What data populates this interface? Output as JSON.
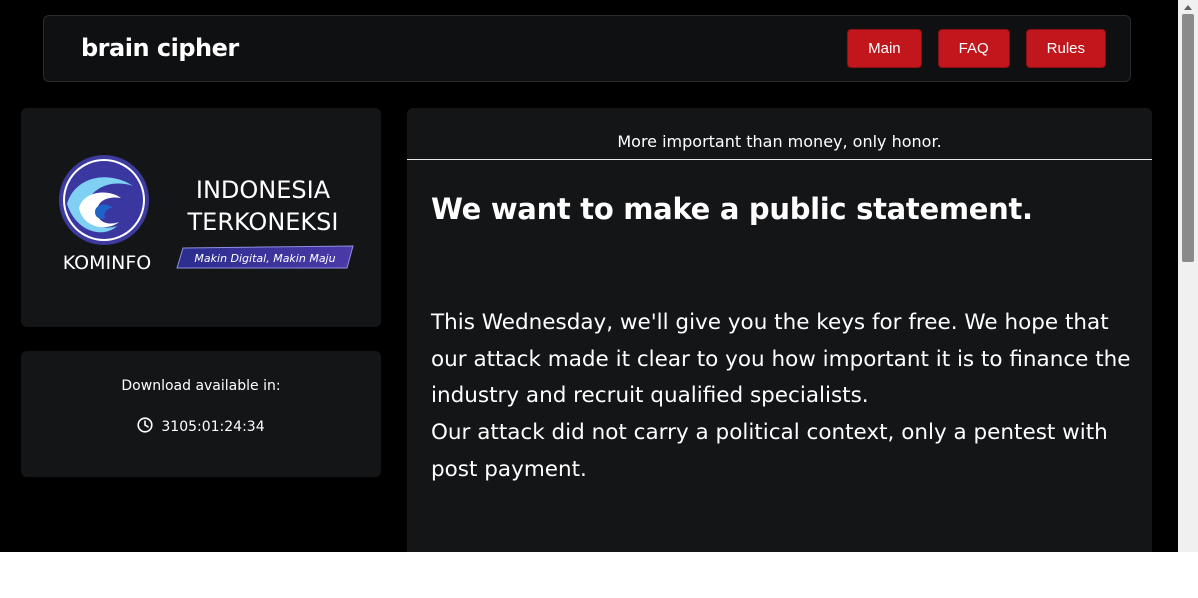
{
  "header": {
    "brand": "brain cipher",
    "nav": [
      {
        "label": "Main"
      },
      {
        "label": "FAQ"
      },
      {
        "label": "Rules"
      }
    ]
  },
  "logo": {
    "org": "KOMINFO",
    "line1": "INDONESIA",
    "line2": "TERKONEKSI",
    "slogan": "Makin Digital, Makin Maju"
  },
  "timer": {
    "title": "Download available in:",
    "countdown": "3105:01:24:34",
    "icon": "clock-icon"
  },
  "main": {
    "tagline": "More important than money, only honor.",
    "heading": "We want to make a public statement.",
    "paragraph1": "This Wednesday, we'll give you the keys for free. We hope that our attack made it clear to you how important it is to finance the industry and recruit qualified specialists.",
    "paragraph2": "Our attack did not carry a political context, only a pentest with post payment."
  },
  "colors": {
    "accent": "#c0161c",
    "background": "#000000",
    "card": "#141517"
  }
}
